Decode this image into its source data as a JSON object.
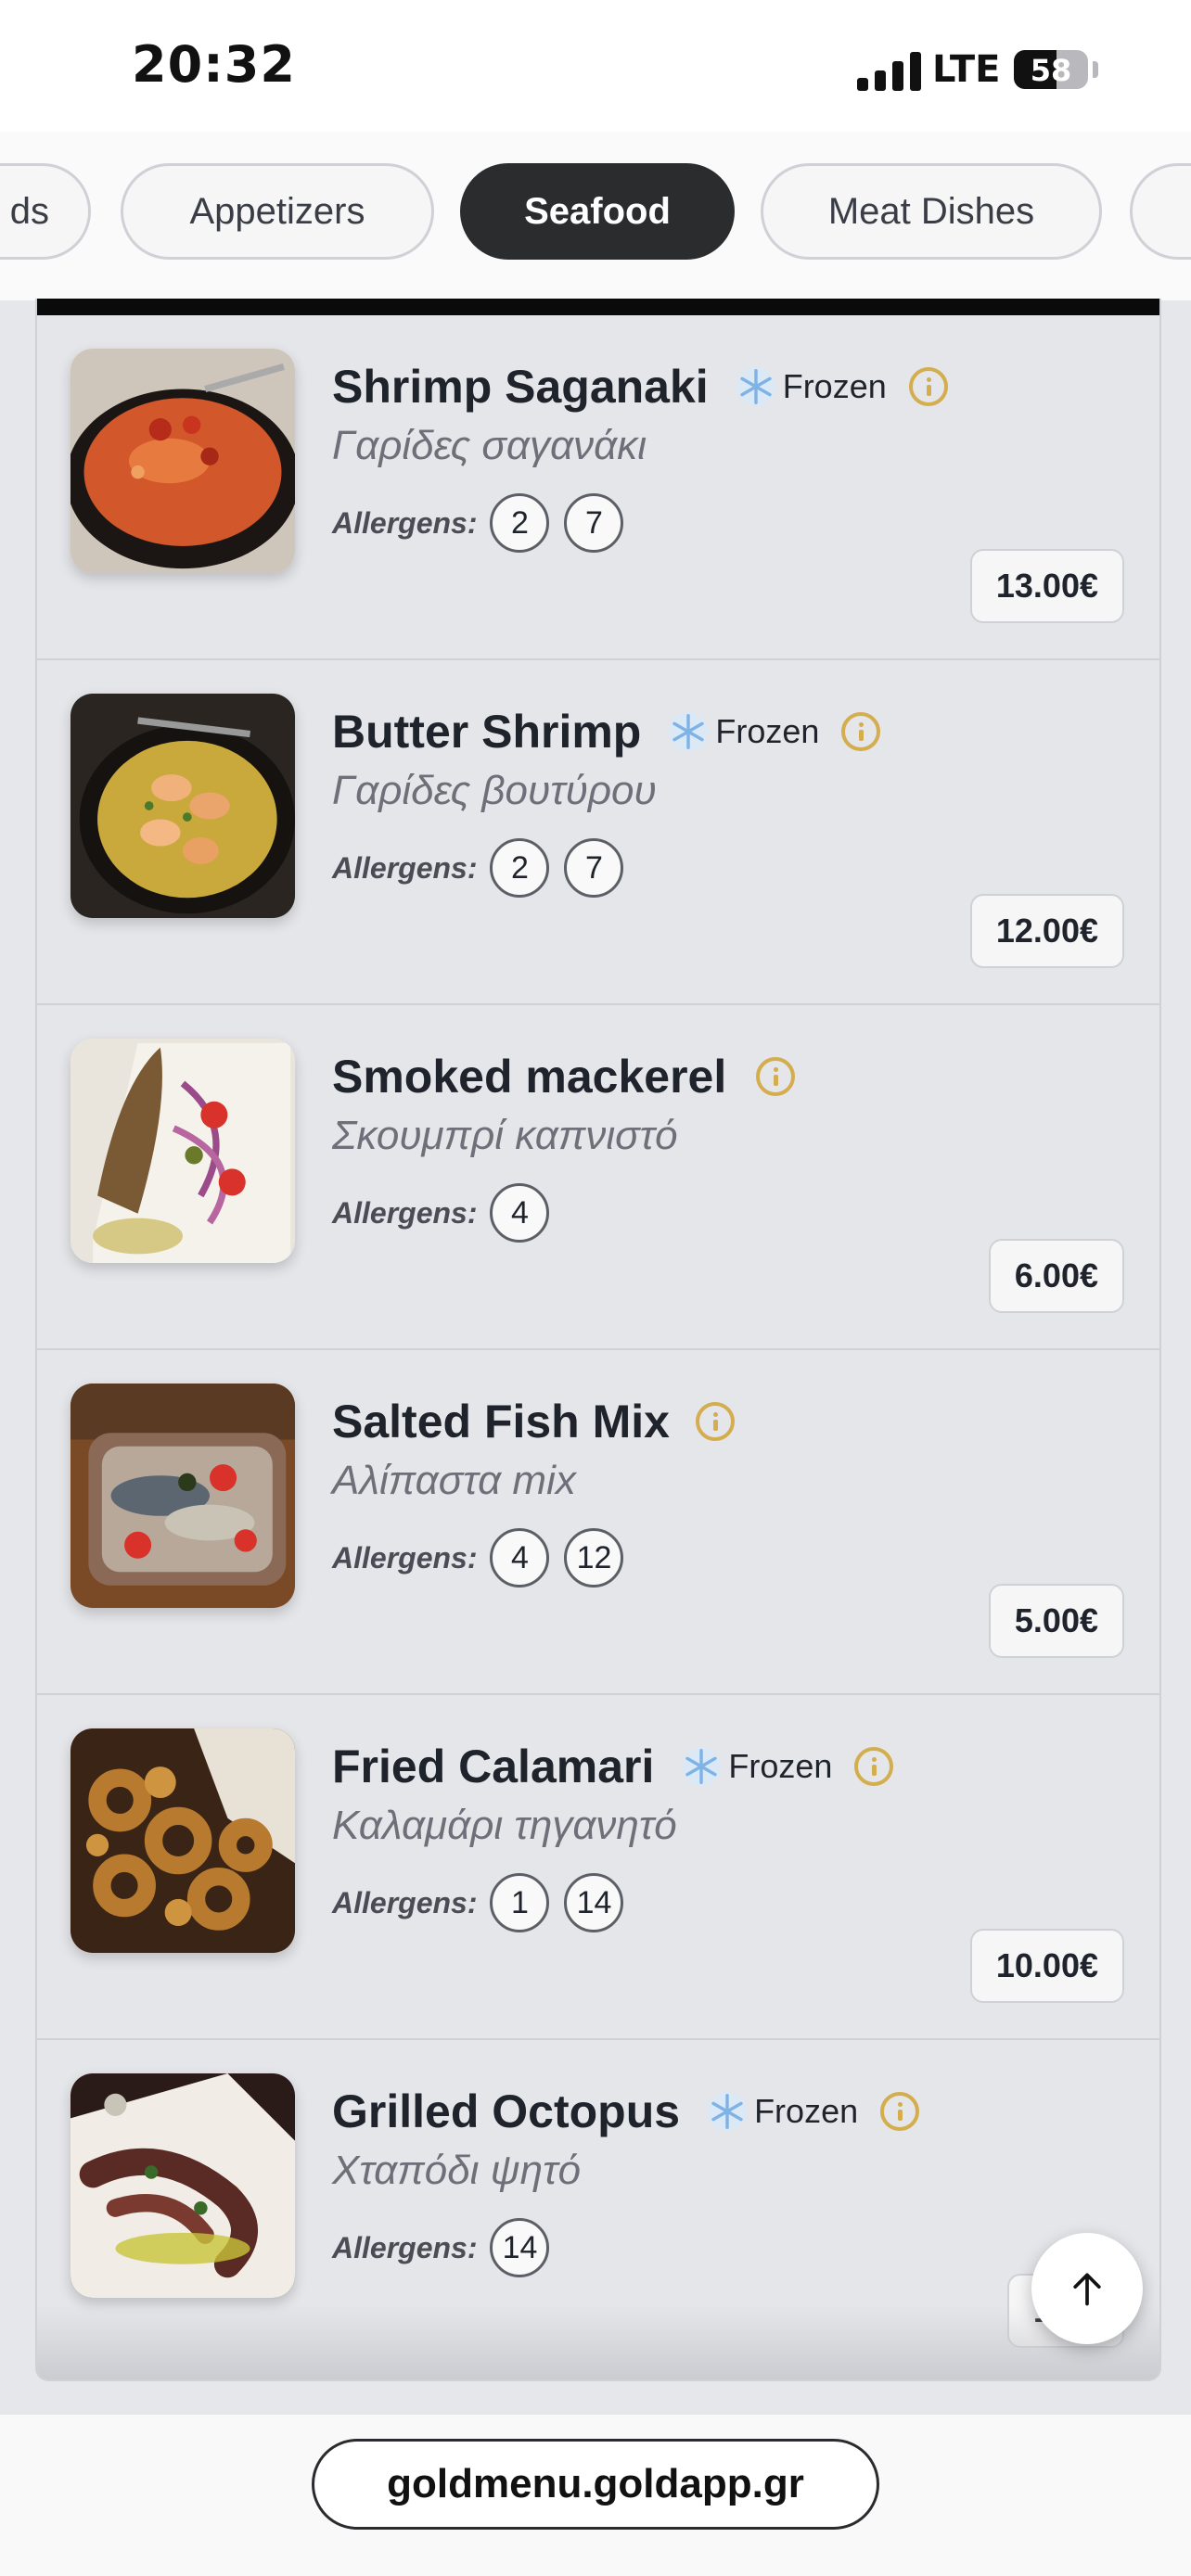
{
  "status_bar": {
    "time": "20:32",
    "network": "LTE",
    "battery": "58",
    "battery_level": 0.58
  },
  "categories": [
    {
      "label": "ds",
      "active": false
    },
    {
      "label": "Appetizers",
      "active": false
    },
    {
      "label": "Seafood",
      "active": true
    },
    {
      "label": "Meat Dishes",
      "active": false
    },
    {
      "label": "",
      "active": false
    }
  ],
  "labels": {
    "allergens": "Allergens:",
    "frozen": "Frozen"
  },
  "items": [
    {
      "title": "Shrimp Saganaki",
      "subtitle": "Γαρίδες σαγανάκι",
      "frozen": true,
      "allergens": [
        "2",
        "7"
      ],
      "price": "13.00€",
      "photo": "shrimp-saganaki-photo"
    },
    {
      "title": "Butter Shrimp",
      "subtitle": "Γαρίδες βουτύρου",
      "frozen": true,
      "allergens": [
        "2",
        "7"
      ],
      "price": "12.00€",
      "photo": "butter-shrimp-photo"
    },
    {
      "title": "Smoked mackerel",
      "subtitle": "Σκουμπρί καπνιστό",
      "frozen": false,
      "allergens": [
        "4"
      ],
      "price": "6.00€",
      "photo": "smoked-mackerel-photo"
    },
    {
      "title": "Salted Fish Mix",
      "subtitle": "Αλίπαστα mix",
      "frozen": false,
      "allergens": [
        "4",
        "12"
      ],
      "price": "5.00€",
      "photo": "salted-fish-mix-photo"
    },
    {
      "title": "Fried Calamari",
      "subtitle": "Καλαμάρι τηγανητό",
      "frozen": true,
      "allergens": [
        "1",
        "14"
      ],
      "price": "10.00€",
      "photo": "fried-calamari-photo"
    },
    {
      "title": "Grilled Octopus",
      "subtitle": "Χταπόδι ψητό",
      "frozen": true,
      "allergens": [
        "14"
      ],
      "price": "13.0",
      "photo": "grilled-octopus-photo"
    }
  ],
  "bottom_bar": {
    "url": "goldmenu.goldapp.gr"
  },
  "icons": {
    "scroll_top": "arrow-up-icon",
    "info": "info-icon",
    "frozen": "snowflake-icon"
  },
  "colors": {
    "accent_gold": "#d3ad4e",
    "active_tab": "#2b2c2e"
  }
}
